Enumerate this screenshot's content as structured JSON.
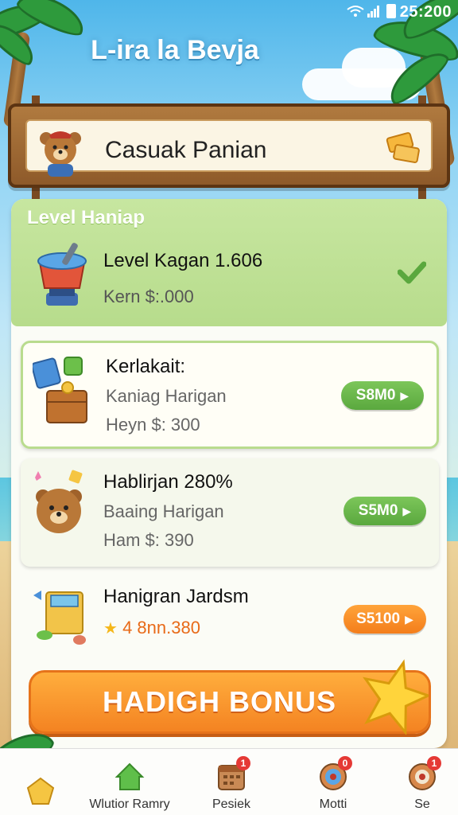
{
  "status_bar": {
    "time": "25:200"
  },
  "app_title": "L-ira la Bevja",
  "sign": {
    "title": "Casuak Panian"
  },
  "level_card": {
    "heading": "Level Haniap",
    "title": "Level Kagan 1.606",
    "subtitle": "Kern $:.000"
  },
  "items": [
    {
      "title": "Kerlakait:",
      "subtitle": "Kaniag Harigan",
      "price_line": "Heyn $: 300",
      "button": "S8M0",
      "button_color": "#6ab84a"
    },
    {
      "title": "Hablirjan 280%",
      "subtitle": "Baaing Harigan",
      "price_line": "Ham $: 390",
      "button": "S5M0",
      "button_color": "#6ab84a"
    },
    {
      "title": "Hanigran Jardsm",
      "subtitle": "4 8nn.380",
      "button": "S5100",
      "button_color": "#f58a22"
    }
  ],
  "bonus_button": "HADIGH BONUS",
  "nav": [
    {
      "label": "",
      "icon": "star-badge-icon"
    },
    {
      "label": "Wlutior Ramry",
      "icon": "home-icon"
    },
    {
      "label": "Pesiek",
      "icon": "calendar-icon",
      "badge": "1"
    },
    {
      "label": "Motti",
      "icon": "target-icon",
      "badge": "0"
    },
    {
      "label": "Se",
      "icon": "target-icon",
      "badge": "1"
    }
  ]
}
